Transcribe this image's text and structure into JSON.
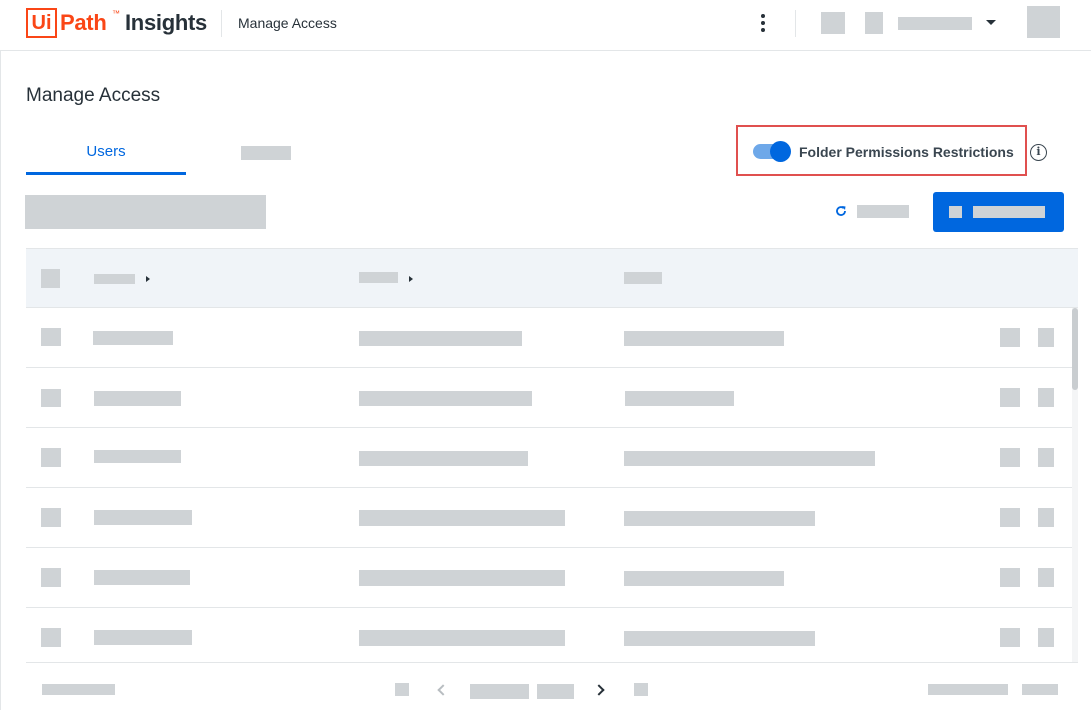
{
  "app": {
    "logo_ui": "Ui",
    "logo_path": "Path",
    "logo_tm": "™",
    "logo_product": "Insights"
  },
  "header": {
    "breadcrumb": "Manage Access"
  },
  "page": {
    "title": "Manage Access"
  },
  "tabs": [
    {
      "label": "Users",
      "active": true
    },
    {
      "label": "",
      "active": false
    }
  ],
  "toggle": {
    "label": "Folder Permissions Restrictions",
    "on": true
  },
  "icons": {
    "kebab": "more-vertical-icon",
    "dropdown": "chevron-down-icon",
    "info": "info-icon",
    "refresh": "refresh-icon",
    "prev": "chevron-left-icon",
    "next": "chevron-right-icon"
  },
  "colors": {
    "brand_orange": "#fa4616",
    "accent_blue": "#0067df",
    "highlight_red": "#e0504f",
    "redaction_gray": "#cfd3d6"
  },
  "table": {
    "row_count": 6
  }
}
